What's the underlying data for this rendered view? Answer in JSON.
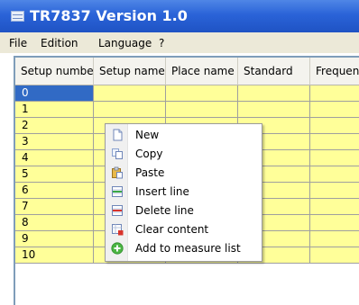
{
  "window": {
    "title": "TR7837 Version 1.0",
    "icon": "app-window-icon"
  },
  "menu": [
    {
      "label": "File"
    },
    {
      "label": "Edition"
    },
    {
      "label": "Language"
    },
    {
      "label": "?"
    }
  ],
  "grid": {
    "columns": [
      "Setup number",
      "Setup name",
      "Place name",
      "Standard",
      "Frequency"
    ],
    "rows": [
      "0",
      "1",
      "2",
      "3",
      "4",
      "5",
      "6",
      "7",
      "8",
      "9",
      "10"
    ],
    "selected_row": "0"
  },
  "context_menu": [
    {
      "label": "New",
      "icon": "new-document-icon"
    },
    {
      "label": "Copy",
      "icon": "copy-icon"
    },
    {
      "label": "Paste",
      "icon": "paste-icon"
    },
    {
      "label": "Insert line",
      "icon": "insert-line-icon"
    },
    {
      "label": "Delete line",
      "icon": "delete-line-icon"
    },
    {
      "label": "Clear content",
      "icon": "clear-content-icon"
    },
    {
      "label": "Add to measure list",
      "icon": "add-to-list-icon"
    }
  ],
  "colors": {
    "cell_background": "#ffff99",
    "selection": "#316ac5",
    "titlebar": "#2a63d8"
  }
}
